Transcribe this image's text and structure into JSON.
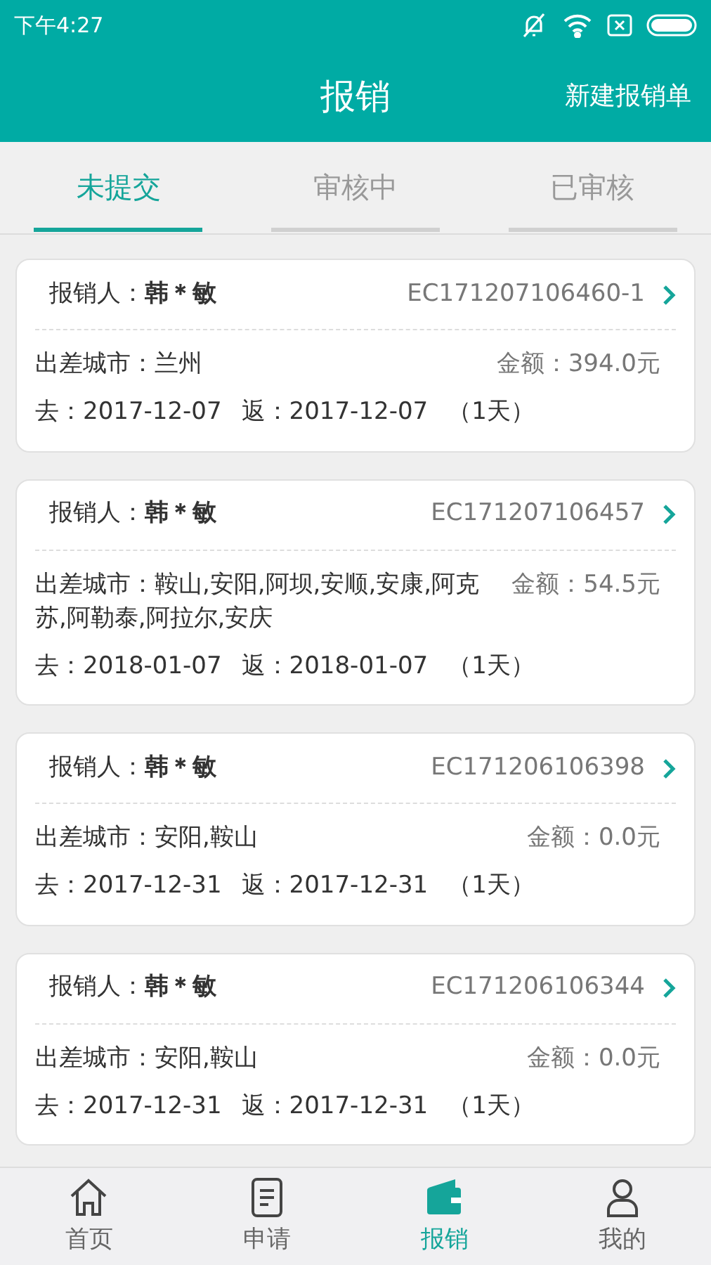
{
  "status_bar": {
    "time": "下午4:27"
  },
  "header": {
    "title": "报销",
    "action": "新建报销单"
  },
  "tabs": [
    {
      "label": "未提交",
      "selected": true
    },
    {
      "label": "审核中",
      "selected": false
    },
    {
      "label": "已审核",
      "selected": false
    }
  ],
  "claims": [
    {
      "claimant_label": "报销人：",
      "claimant": "韩＊敏",
      "number": "EC171207106460-1",
      "city": "出差城市：兰州",
      "amount": "金额：394.0元",
      "departure": "去：2017-12-07",
      "return": "返：2017-12-07",
      "duration": "（1天）"
    },
    {
      "claimant_label": "报销人：",
      "claimant": "韩＊敏",
      "number": "EC171207106457",
      "city": "出差城市：鞍山,安阳,阿坝,安顺,安康,阿克苏,阿勒泰,阿拉尔,安庆",
      "amount": "金额：54.5元",
      "departure": "去：2018-01-07",
      "return": "返：2018-01-07",
      "duration": "（1天）"
    },
    {
      "claimant_label": "报销人：",
      "claimant": "韩＊敏",
      "number": "EC171206106398",
      "city": "出差城市：安阳,鞍山",
      "amount": "金额：0.0元",
      "departure": "去：2017-12-31",
      "return": "返：2017-12-31",
      "duration": "（1天）"
    },
    {
      "claimant_label": "报销人：",
      "claimant": "韩＊敏",
      "number": "EC171206106344",
      "city": "出差城市：安阳,鞍山",
      "amount": "金额：0.0元",
      "departure": "去：2017-12-31",
      "return": "返：2017-12-31",
      "duration": "（1天）"
    }
  ],
  "bottom_nav": [
    {
      "kind": "home",
      "label": "首页",
      "selected": false
    },
    {
      "kind": "document",
      "label": "申请",
      "selected": false
    },
    {
      "kind": "wallet",
      "label": "报销",
      "selected": true
    },
    {
      "kind": "person",
      "label": "我的",
      "selected": false
    }
  ]
}
